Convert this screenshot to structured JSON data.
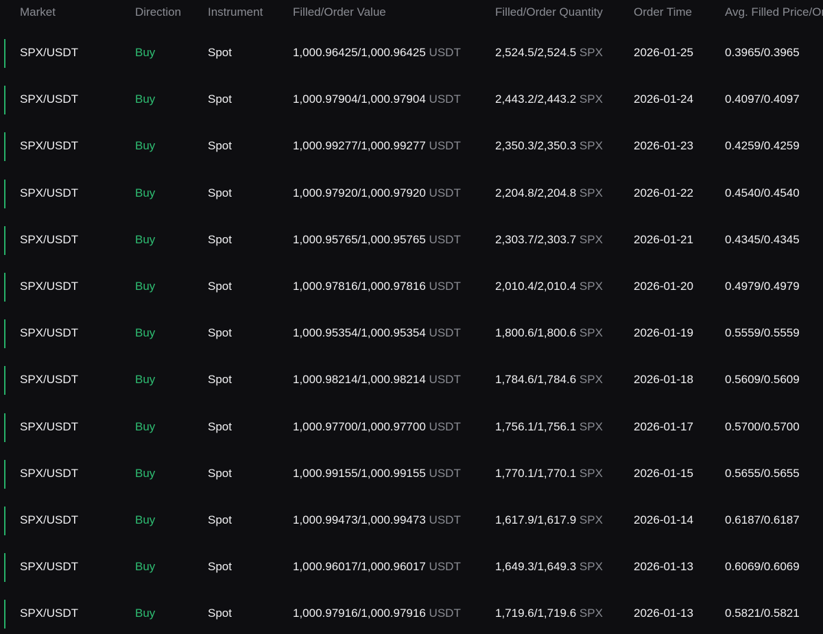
{
  "columns": {
    "market": "Market",
    "direction": "Direction",
    "instrument": "Instrument",
    "value": "Filled/Order Value",
    "quantity": "Filled/Order Quantity",
    "time": "Order Time",
    "price": "Avg. Filled Price/Order Price"
  },
  "colors": {
    "background": "#0e0e11",
    "buy": "#2ebd72",
    "muted": "#8a8c93",
    "text": "#f2f2f4"
  },
  "rows": [
    {
      "market": "SPX/USDT",
      "direction": "Buy",
      "instrument": "Spot",
      "value": "1,000.96425/1,000.96425",
      "value_unit": "USDT",
      "quantity": "2,524.5/2,524.5",
      "quantity_unit": "SPX",
      "time": "2026-01-25",
      "price": "0.3965/0.3965"
    },
    {
      "market": "SPX/USDT",
      "direction": "Buy",
      "instrument": "Spot",
      "value": "1,000.97904/1,000.97904",
      "value_unit": "USDT",
      "quantity": "2,443.2/2,443.2",
      "quantity_unit": "SPX",
      "time": "2026-01-24",
      "price": "0.4097/0.4097"
    },
    {
      "market": "SPX/USDT",
      "direction": "Buy",
      "instrument": "Spot",
      "value": "1,000.99277/1,000.99277",
      "value_unit": "USDT",
      "quantity": "2,350.3/2,350.3",
      "quantity_unit": "SPX",
      "time": "2026-01-23",
      "price": "0.4259/0.4259"
    },
    {
      "market": "SPX/USDT",
      "direction": "Buy",
      "instrument": "Spot",
      "value": "1,000.97920/1,000.97920",
      "value_unit": "USDT",
      "quantity": "2,204.8/2,204.8",
      "quantity_unit": "SPX",
      "time": "2026-01-22",
      "price": "0.4540/0.4540"
    },
    {
      "market": "SPX/USDT",
      "direction": "Buy",
      "instrument": "Spot",
      "value": "1,000.95765/1,000.95765",
      "value_unit": "USDT",
      "quantity": "2,303.7/2,303.7",
      "quantity_unit": "SPX",
      "time": "2026-01-21",
      "price": "0.4345/0.4345"
    },
    {
      "market": "SPX/USDT",
      "direction": "Buy",
      "instrument": "Spot",
      "value": "1,000.97816/1,000.97816",
      "value_unit": "USDT",
      "quantity": "2,010.4/2,010.4",
      "quantity_unit": "SPX",
      "time": "2026-01-20",
      "price": "0.4979/0.4979"
    },
    {
      "market": "SPX/USDT",
      "direction": "Buy",
      "instrument": "Spot",
      "value": "1,000.95354/1,000.95354",
      "value_unit": "USDT",
      "quantity": "1,800.6/1,800.6",
      "quantity_unit": "SPX",
      "time": "2026-01-19",
      "price": "0.5559/0.5559"
    },
    {
      "market": "SPX/USDT",
      "direction": "Buy",
      "instrument": "Spot",
      "value": "1,000.98214/1,000.98214",
      "value_unit": "USDT",
      "quantity": "1,784.6/1,784.6",
      "quantity_unit": "SPX",
      "time": "2026-01-18",
      "price": "0.5609/0.5609"
    },
    {
      "market": "SPX/USDT",
      "direction": "Buy",
      "instrument": "Spot",
      "value": "1,000.97700/1,000.97700",
      "value_unit": "USDT",
      "quantity": "1,756.1/1,756.1",
      "quantity_unit": "SPX",
      "time": "2026-01-17",
      "price": "0.5700/0.5700"
    },
    {
      "market": "SPX/USDT",
      "direction": "Buy",
      "instrument": "Spot",
      "value": "1,000.99155/1,000.99155",
      "value_unit": "USDT",
      "quantity": "1,770.1/1,770.1",
      "quantity_unit": "SPX",
      "time": "2026-01-15",
      "price": "0.5655/0.5655"
    },
    {
      "market": "SPX/USDT",
      "direction": "Buy",
      "instrument": "Spot",
      "value": "1,000.99473/1,000.99473",
      "value_unit": "USDT",
      "quantity": "1,617.9/1,617.9",
      "quantity_unit": "SPX",
      "time": "2026-01-14",
      "price": "0.6187/0.6187"
    },
    {
      "market": "SPX/USDT",
      "direction": "Buy",
      "instrument": "Spot",
      "value": "1,000.96017/1,000.96017",
      "value_unit": "USDT",
      "quantity": "1,649.3/1,649.3",
      "quantity_unit": "SPX",
      "time": "2026-01-13",
      "price": "0.6069/0.6069"
    },
    {
      "market": "SPX/USDT",
      "direction": "Buy",
      "instrument": "Spot",
      "value": "1,000.97916/1,000.97916",
      "value_unit": "USDT",
      "quantity": "1,719.6/1,719.6",
      "quantity_unit": "SPX",
      "time": "2026-01-13",
      "price": "0.5821/0.5821"
    }
  ]
}
